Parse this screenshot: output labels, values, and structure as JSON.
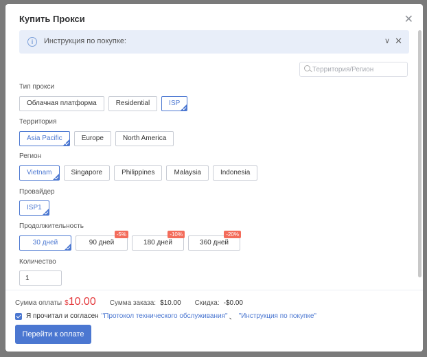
{
  "dialog": {
    "title": "Купить Прокси"
  },
  "info": {
    "text": "Инструкция по покупке:"
  },
  "search": {
    "placeholder": "Территория/Регион"
  },
  "proxy_type": {
    "label": "Тип прокси",
    "options": [
      "Облачная платформа",
      "Residential",
      "ISP"
    ],
    "selected": "ISP"
  },
  "territory": {
    "label": "Территория",
    "options": [
      "Asia Pacific",
      "Europe",
      "North America"
    ],
    "selected": "Asia Pacific"
  },
  "region": {
    "label": "Регион",
    "options": [
      "Vietnam",
      "Singapore",
      "Philippines",
      "Malaysia",
      "Indonesia"
    ],
    "selected": "Vietnam"
  },
  "provider": {
    "label": "Провайдер",
    "options": [
      "ISP1"
    ],
    "selected": "ISP1"
  },
  "duration": {
    "label": "Продолжительность",
    "options": [
      {
        "label": "30 дней",
        "badge": ""
      },
      {
        "label": "90 дней",
        "badge": "-5%"
      },
      {
        "label": "180 дней",
        "badge": "-10%"
      },
      {
        "label": "360 дней",
        "badge": "-20%"
      }
    ],
    "selected": "30 дней"
  },
  "quantity": {
    "label": "Количество",
    "value": "1"
  },
  "footer": {
    "payment_label": "Сумма оплаты",
    "payment_currency": "$",
    "payment_amount": "10.00",
    "order_label": "Сумма заказа:",
    "order_value": "$10.00",
    "discount_label": "Скидка:",
    "discount_value": "-$0.00",
    "agree_text": "Я прочитал и согласен",
    "link1": "\"Протокол технического обслуживания\"",
    "separator": "、",
    "link2": "\"Инструкция по покупке\"",
    "checked": true,
    "pay_button": "Перейти к оплате"
  },
  "colors": {
    "accent": "#4b77d1",
    "price": "#e4393c",
    "badge": "#f36c5b",
    "info_bg": "#e8eef9"
  }
}
